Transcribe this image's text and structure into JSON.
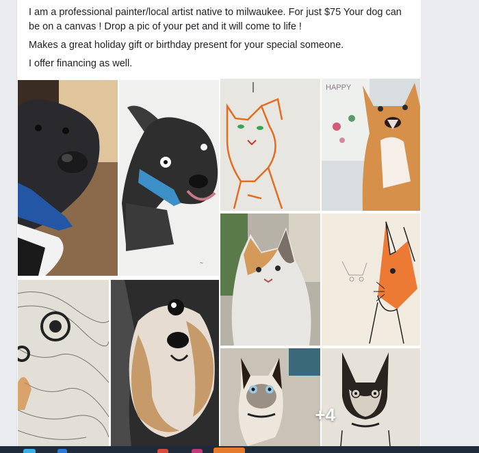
{
  "post": {
    "paragraphs": [
      "I am a professional painter/local artist native to milwaukee. For just $75 Your dog can be on a canvas ! Drop a pic of your pet and it will come to life !",
      "Makes a great holiday gift or birthday present for your special someone.",
      "I offer financing as well."
    ]
  },
  "gallery": {
    "more_count": "+4",
    "tiles": [
      {
        "icon": "dog-photo"
      },
      {
        "icon": "dog-drawing"
      },
      {
        "icon": "cat-drawing"
      },
      {
        "icon": "cat-photo"
      },
      {
        "icon": "cat-photo"
      },
      {
        "icon": "cat-drawing"
      },
      {
        "icon": "dog-drawing"
      },
      {
        "icon": "dog-photo"
      },
      {
        "icon": "cat-photo"
      },
      {
        "icon": "cat-drawing"
      }
    ]
  },
  "colors": {
    "page_bg": "#e9ebee",
    "card_bg": "#ffffff",
    "text": "#1c1e21",
    "taskbar": "#1f2a3a"
  }
}
